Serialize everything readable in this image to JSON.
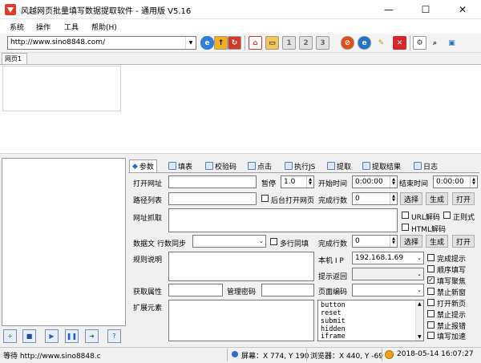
{
  "window": {
    "title": "风越网页批量填写数据提取软件 - 通用版 V5.16",
    "minimize": "—",
    "maximize": "☐",
    "close": "✕"
  },
  "menu": [
    "系统",
    "操作",
    "工具",
    "帮助(H)"
  ],
  "toolbar": {
    "url": "http://www.sino8848.com/",
    "icons": [
      "go-icon",
      "stop-icon",
      "refresh-icon",
      "home-icon",
      "open-folder-icon",
      "zoom-1-icon",
      "zoom-2-icon",
      "zoom-3-icon",
      "block-icon",
      "ie-icon",
      "highlight-icon",
      "delete-icon",
      "settings-icon",
      "search-icon",
      "window-icon"
    ]
  },
  "tabs": {
    "page_tab": "网页1",
    "param_tabs": [
      "参数",
      "填表",
      "校验码",
      "点击",
      "执行JS",
      "提取",
      "提取结果",
      "日志"
    ]
  },
  "form": {
    "open_url_label": "打开网址",
    "pause_label": "暂停",
    "pause_value": "1.0",
    "start_time_label": "开始时间",
    "start_time_value": "0:00:00",
    "end_time_label": "结束时间",
    "end_time_value": "0:00:00",
    "path_list_label": "路径列表",
    "bg_open_label": "后台打开网页",
    "done_rows_label": "完成行数",
    "done_rows_value": "0",
    "select_label": "选择",
    "generate_label": "生成",
    "open_label": "打开",
    "url_grab_label": "网址抓取",
    "url_decode_label": "URL解码",
    "regex_label": "正则式",
    "html_decode_label": "HTML解码",
    "data_file_label": "数据文",
    "row_sync_label": "行数同步",
    "multi_row_label": "多行同填",
    "done_rows2_label": "完成行数",
    "done_rows2_value": "0",
    "rule_desc_label": "规则说明",
    "local_ip_label": "本机 I P",
    "local_ip_value": "192.168.1.69",
    "prompt_return_label": "提示返回",
    "get_attr_label": "获取属性",
    "manage_pwd_label": "管理密码",
    "page_encoding_label": "页面编码",
    "ext_elem_label": "扩展元素",
    "elements": [
      "button",
      "reset",
      "submit",
      "hidden",
      "iframe"
    ],
    "options": [
      {
        "label": "完成提示",
        "checked": false
      },
      {
        "label": "顺序填写",
        "checked": false
      },
      {
        "label": "填写聚焦",
        "checked": true
      },
      {
        "label": "禁止新窗",
        "checked": false
      },
      {
        "label": "打开新页",
        "checked": false
      },
      {
        "label": "禁止提示",
        "checked": false
      },
      {
        "label": "禁止报错",
        "checked": false
      },
      {
        "label": "填写加速",
        "checked": false
      }
    ]
  },
  "left_buttons": [
    "add-icon",
    "save-icon",
    "play-icon",
    "pause-icon",
    "export-icon",
    "help-icon"
  ],
  "status": {
    "state": "等待 http://www.sino8848.c",
    "screen": "屏幕：X 774, Y 190",
    "browser": "浏览器：X 440, Y -69",
    "datetime": "2018-05-14 16:07:27"
  },
  "colors": {
    "accent": "#1a6fd0",
    "red": "#d42a1e",
    "orange": "#f3a31a"
  }
}
